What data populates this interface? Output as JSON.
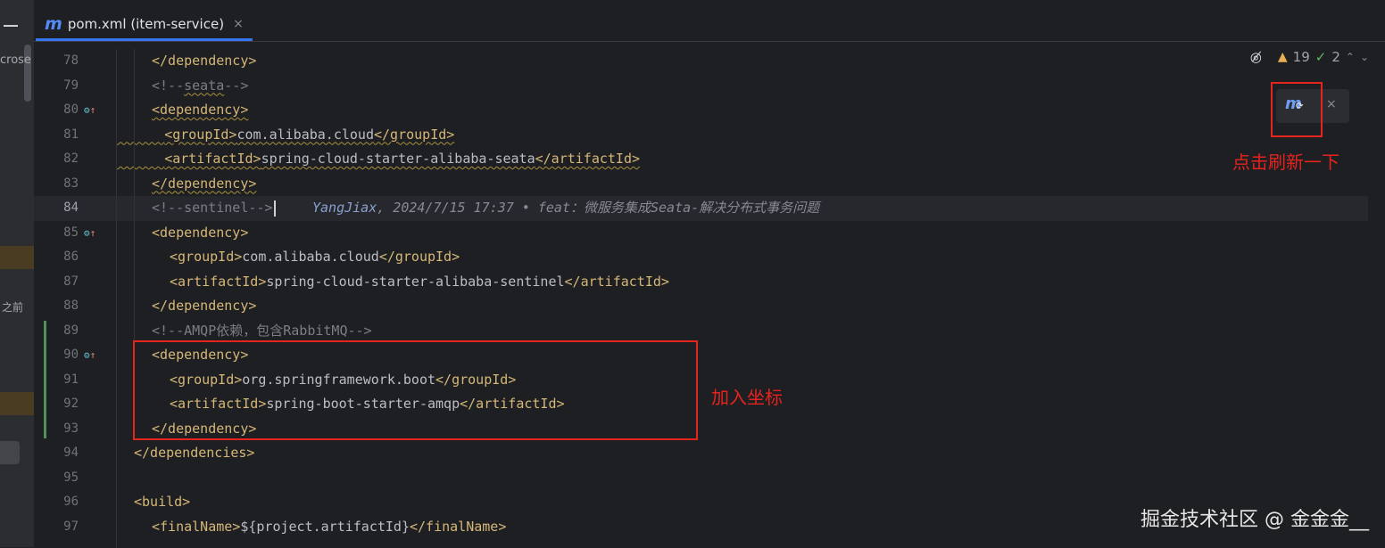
{
  "left_panel": {
    "fragment_top": "crose",
    "fragment_mid": "之前"
  },
  "tab": {
    "icon_letter": "m",
    "title": "pom.xml (item-service)",
    "close": "×"
  },
  "status": {
    "hidden_icon": "eye-crossed-icon",
    "warnings": "19",
    "ok_count": "2",
    "up": "⌃",
    "down": "⌄"
  },
  "maven_popup": {
    "icon_letter": "m",
    "refresh_glyph": "⟳",
    "close": "×"
  },
  "editor": {
    "lines": [
      {
        "num": "78",
        "indent": 1,
        "parts": [
          [
            "t",
            "</dependency>"
          ]
        ]
      },
      {
        "num": "79",
        "indent": 1,
        "parts": [
          [
            "c",
            "<!--"
          ],
          [
            "cw",
            "seata"
          ],
          [
            "c",
            "-->"
          ]
        ]
      },
      {
        "num": "80",
        "indent": 1,
        "icon": true,
        "parts": [
          [
            "tw",
            "<dependency>"
          ]
        ]
      },
      {
        "num": "81",
        "indent": 2,
        "wavylead": true,
        "parts": [
          [
            "tw",
            "<groupId>"
          ],
          [
            "xw",
            "com.alibaba.cloud"
          ],
          [
            "tw",
            "</groupId>"
          ]
        ]
      },
      {
        "num": "82",
        "indent": 2,
        "wavylead": true,
        "parts": [
          [
            "tw",
            "<artifactId>"
          ],
          [
            "xw",
            "spring-cloud-starter-alibaba-seata"
          ],
          [
            "tw",
            "</artifactId>"
          ]
        ]
      },
      {
        "num": "83",
        "indent": 1,
        "parts": [
          [
            "tw",
            "</dependency>"
          ]
        ]
      },
      {
        "num": "84",
        "indent": 1,
        "current": true,
        "parts": [
          [
            "c",
            "<!--sentinel-->"
          ]
        ]
      },
      {
        "num": "85",
        "indent": 1,
        "icon": true,
        "parts": [
          [
            "t",
            "<dependency>"
          ]
        ]
      },
      {
        "num": "86",
        "indent": 2,
        "parts": [
          [
            "t",
            "<groupId>"
          ],
          [
            "x",
            "com.alibaba.cloud"
          ],
          [
            "t",
            "</groupId>"
          ]
        ]
      },
      {
        "num": "87",
        "indent": 2,
        "parts": [
          [
            "t",
            "<artifactId>"
          ],
          [
            "x",
            "spring-cloud-starter-alibaba-sentinel"
          ],
          [
            "t",
            "</artifactId>"
          ]
        ]
      },
      {
        "num": "88",
        "indent": 1,
        "parts": [
          [
            "t",
            "</dependency>"
          ]
        ]
      },
      {
        "num": "89",
        "indent": 1,
        "parts": [
          [
            "c",
            "<!--AMQP依赖，包含RabbitMQ-->"
          ]
        ]
      },
      {
        "num": "90",
        "indent": 1,
        "icon": true,
        "parts": [
          [
            "t",
            "<dependency>"
          ]
        ]
      },
      {
        "num": "91",
        "indent": 2,
        "parts": [
          [
            "t",
            "<groupId>"
          ],
          [
            "x",
            "org.springframework.boot"
          ],
          [
            "t",
            "</groupId>"
          ]
        ]
      },
      {
        "num": "92",
        "indent": 2,
        "parts": [
          [
            "t",
            "<artifactId>"
          ],
          [
            "x",
            "spring-boot-starter-amqp"
          ],
          [
            "t",
            "</artifactId>"
          ]
        ]
      },
      {
        "num": "93",
        "indent": 1,
        "parts": [
          [
            "t",
            "</dependency>"
          ]
        ]
      },
      {
        "num": "94",
        "indent": 0,
        "parts": [
          [
            "t",
            "</dependencies>"
          ]
        ]
      },
      {
        "num": "95",
        "indent": 0,
        "parts": []
      },
      {
        "num": "96",
        "indent": 0,
        "parts": [
          [
            "t",
            "<build>"
          ]
        ]
      },
      {
        "num": "97",
        "indent": 1,
        "parts": [
          [
            "t",
            "<finalName>"
          ],
          [
            "x",
            "${project.artifactId}"
          ],
          [
            "t",
            "</finalName>"
          ]
        ]
      }
    ],
    "blame": {
      "author": "YangJiax",
      "datetime": ", 2024/7/15 17:37",
      "sep": " • ",
      "message": "feat：微服务集成Seata-解决分布式事务问题"
    }
  },
  "annotations": {
    "refresh_note": "点击刷新一下",
    "deps_note": "加入坐标"
  },
  "watermark": "掘金技术社区 @ 金金金__",
  "colors": {
    "tag": "#d5b778",
    "comment": "#7a7e85",
    "accent": "#3574f0",
    "annotation_red": "#e4251e"
  }
}
